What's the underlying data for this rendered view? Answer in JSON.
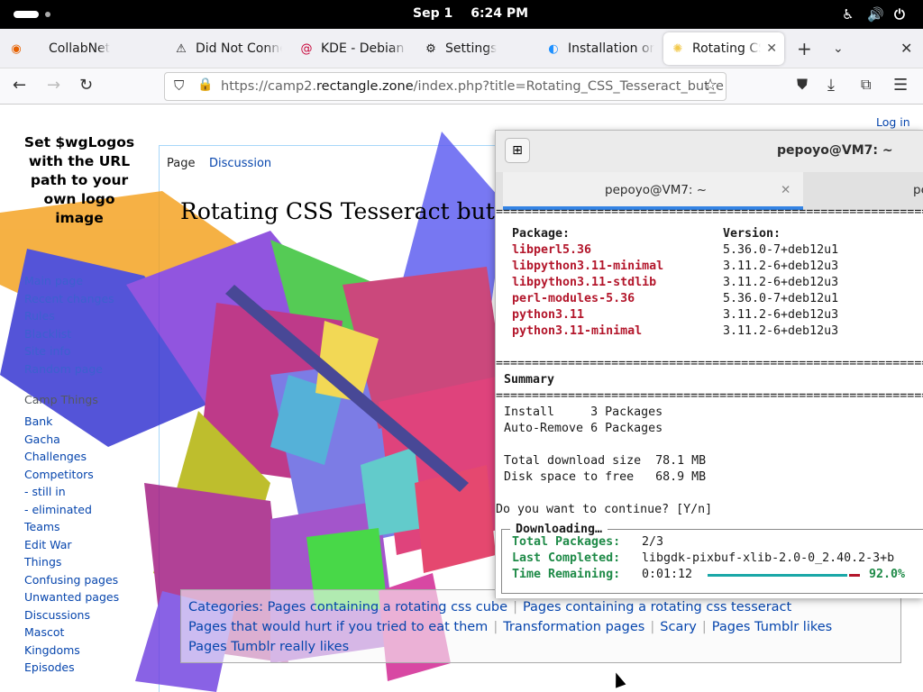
{
  "topbar": {
    "date": "Sep 1",
    "time": "6:24 PM"
  },
  "browser": {
    "tabs": [
      {
        "label": "CollabNet",
        "icon": "firefox-icon"
      },
      {
        "label": "Did Not Conne",
        "icon": "warning-icon"
      },
      {
        "label": "KDE - Debian V",
        "icon": "debian-icon"
      },
      {
        "label": "Settings",
        "icon": "gear-icon"
      },
      {
        "label": "Installation on",
        "icon": "globe-icon"
      },
      {
        "label": "Rotating CSS",
        "icon": "page-icon",
        "active": true
      }
    ],
    "url_prefix": "https://camp2.",
    "url_domain": "rectangle.zone",
    "url_rest": "/index.php?title=Rotating_CSS_Tesseract_but_e"
  },
  "wiki": {
    "logo_text": "Set $wgLogos with the URL path to your own logo image",
    "login": "Log in",
    "tab_page": "Page",
    "tab_discussion": "Discussion",
    "title": "Rotating CSS Tesseract but ev",
    "nav_main": [
      "Main page",
      "Recent changes",
      "Rules",
      "Blacklist",
      "Site info",
      "Random page"
    ],
    "camp_heading": "Camp Things",
    "nav_camp": [
      "Bank",
      "Gacha",
      "Challenges",
      "Competitors",
      "- still in",
      "- eliminated",
      "Teams",
      "Edit War",
      "Things",
      "Confusing pages",
      "Unwanted pages",
      "Discussions",
      "Mascot",
      "Kingdoms",
      "Episodes"
    ],
    "categories_label": "Categories:",
    "categories": [
      "Pages containing a rotating css cube",
      "Pages containing a rotating css tesseract",
      "Pages that would hurt if you tried to eat them",
      "Transformation pages",
      "Scary",
      "Pages Tumblr likes",
      "Pages Tumblr really likes"
    ]
  },
  "terminal": {
    "title": "pepoyo@VM7: ~",
    "tab1": "pepoyo@VM7: ~",
    "tab2": "pe",
    "rule": "================================================================",
    "pkg_header": "Package:",
    "ver_header": "Version:",
    "packages": [
      {
        "name": "libperl5.36",
        "version": "5.36.0-7+deb12u1"
      },
      {
        "name": "libpython3.11-minimal",
        "version": "3.11.2-6+deb12u3"
      },
      {
        "name": "libpython3.11-stdlib",
        "version": "3.11.2-6+deb12u3"
      },
      {
        "name": "perl-modules-5.36",
        "version": "5.36.0-7+deb12u1"
      },
      {
        "name": "python3.11",
        "version": "3.11.2-6+deb12u3"
      },
      {
        "name": "python3.11-minimal",
        "version": "3.11.2-6+deb12u3"
      }
    ],
    "summary": "Summary",
    "install_line": "Install     3 Packages",
    "autoremove_line": "Auto-Remove 6 Packages",
    "download_line": "Total download size  78.1 MB",
    "disk_line": "Disk space to free   68.9 MB",
    "prompt": "Do you want to continue? [Y/n]",
    "dl_title": "Downloading…",
    "total_label": "Total Packages:",
    "total_value": "2/3",
    "last_label": "Last Completed:",
    "last_value": "libgdk-pixbuf-xlib-2.0-0_2.40.2-3+b",
    "time_label": "Time Remaining:",
    "time_value": "0:01:12",
    "percent": "92.0%",
    "progress_fraction": 0.92
  }
}
